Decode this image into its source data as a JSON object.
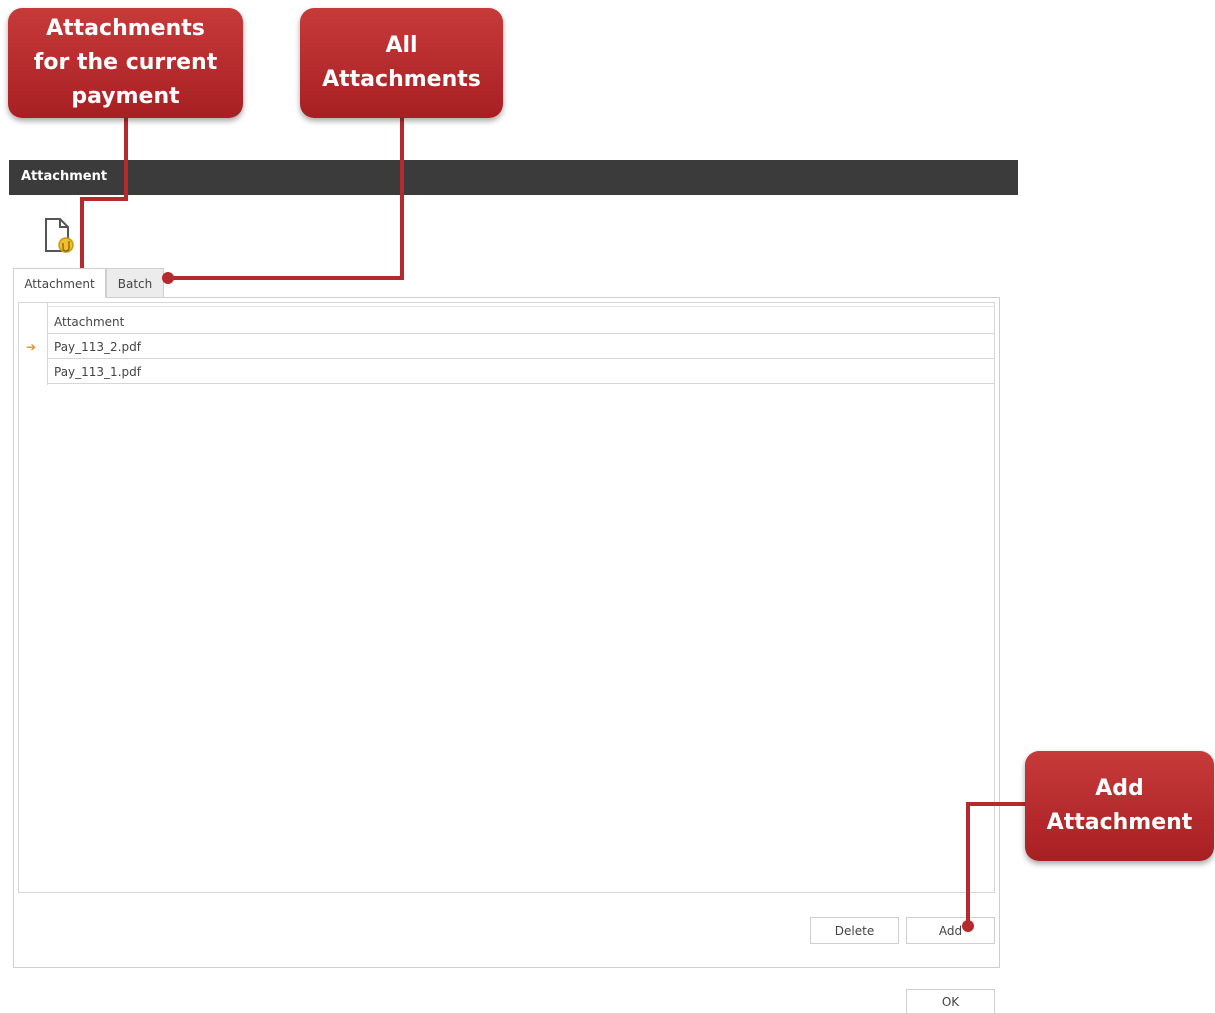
{
  "window": {
    "title": "Attachment"
  },
  "toolbar": {
    "icon": "attachment-file-icon"
  },
  "tabs": [
    {
      "label": "Attachment",
      "active": true
    },
    {
      "label": "Batch",
      "active": false
    }
  ],
  "grid": {
    "column_header": "Attachment",
    "rows": [
      {
        "name": "Pay_113_2.pdf",
        "current": true
      },
      {
        "name": "Pay_113_1.pdf",
        "current": false
      }
    ]
  },
  "buttons": {
    "delete": "Delete",
    "add": "Add",
    "ok": "OK"
  },
  "callouts": {
    "current": "Attachments\nfor the current\npayment",
    "all": "All\nAttachments",
    "add": "Add\nAttachment"
  },
  "colors": {
    "callout": "#b52a2d",
    "titlebar": "#3b3b3b",
    "row_indicator": "#e8912d"
  }
}
